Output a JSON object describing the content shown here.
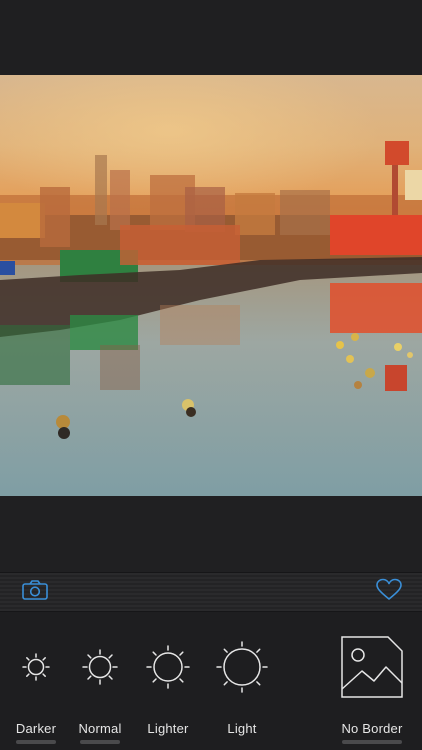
{
  "photo": {
    "description_icon": "watercolor-photo"
  },
  "toolbar": {
    "camera_icon": "camera-icon",
    "favorite_icon": "heart-icon",
    "accent": "#3a8fd8"
  },
  "filters": [
    {
      "label": "Darker"
    },
    {
      "label": "Normal"
    },
    {
      "label": "Lighter"
    },
    {
      "label": "Light"
    },
    {
      "label": "No Border"
    }
  ]
}
